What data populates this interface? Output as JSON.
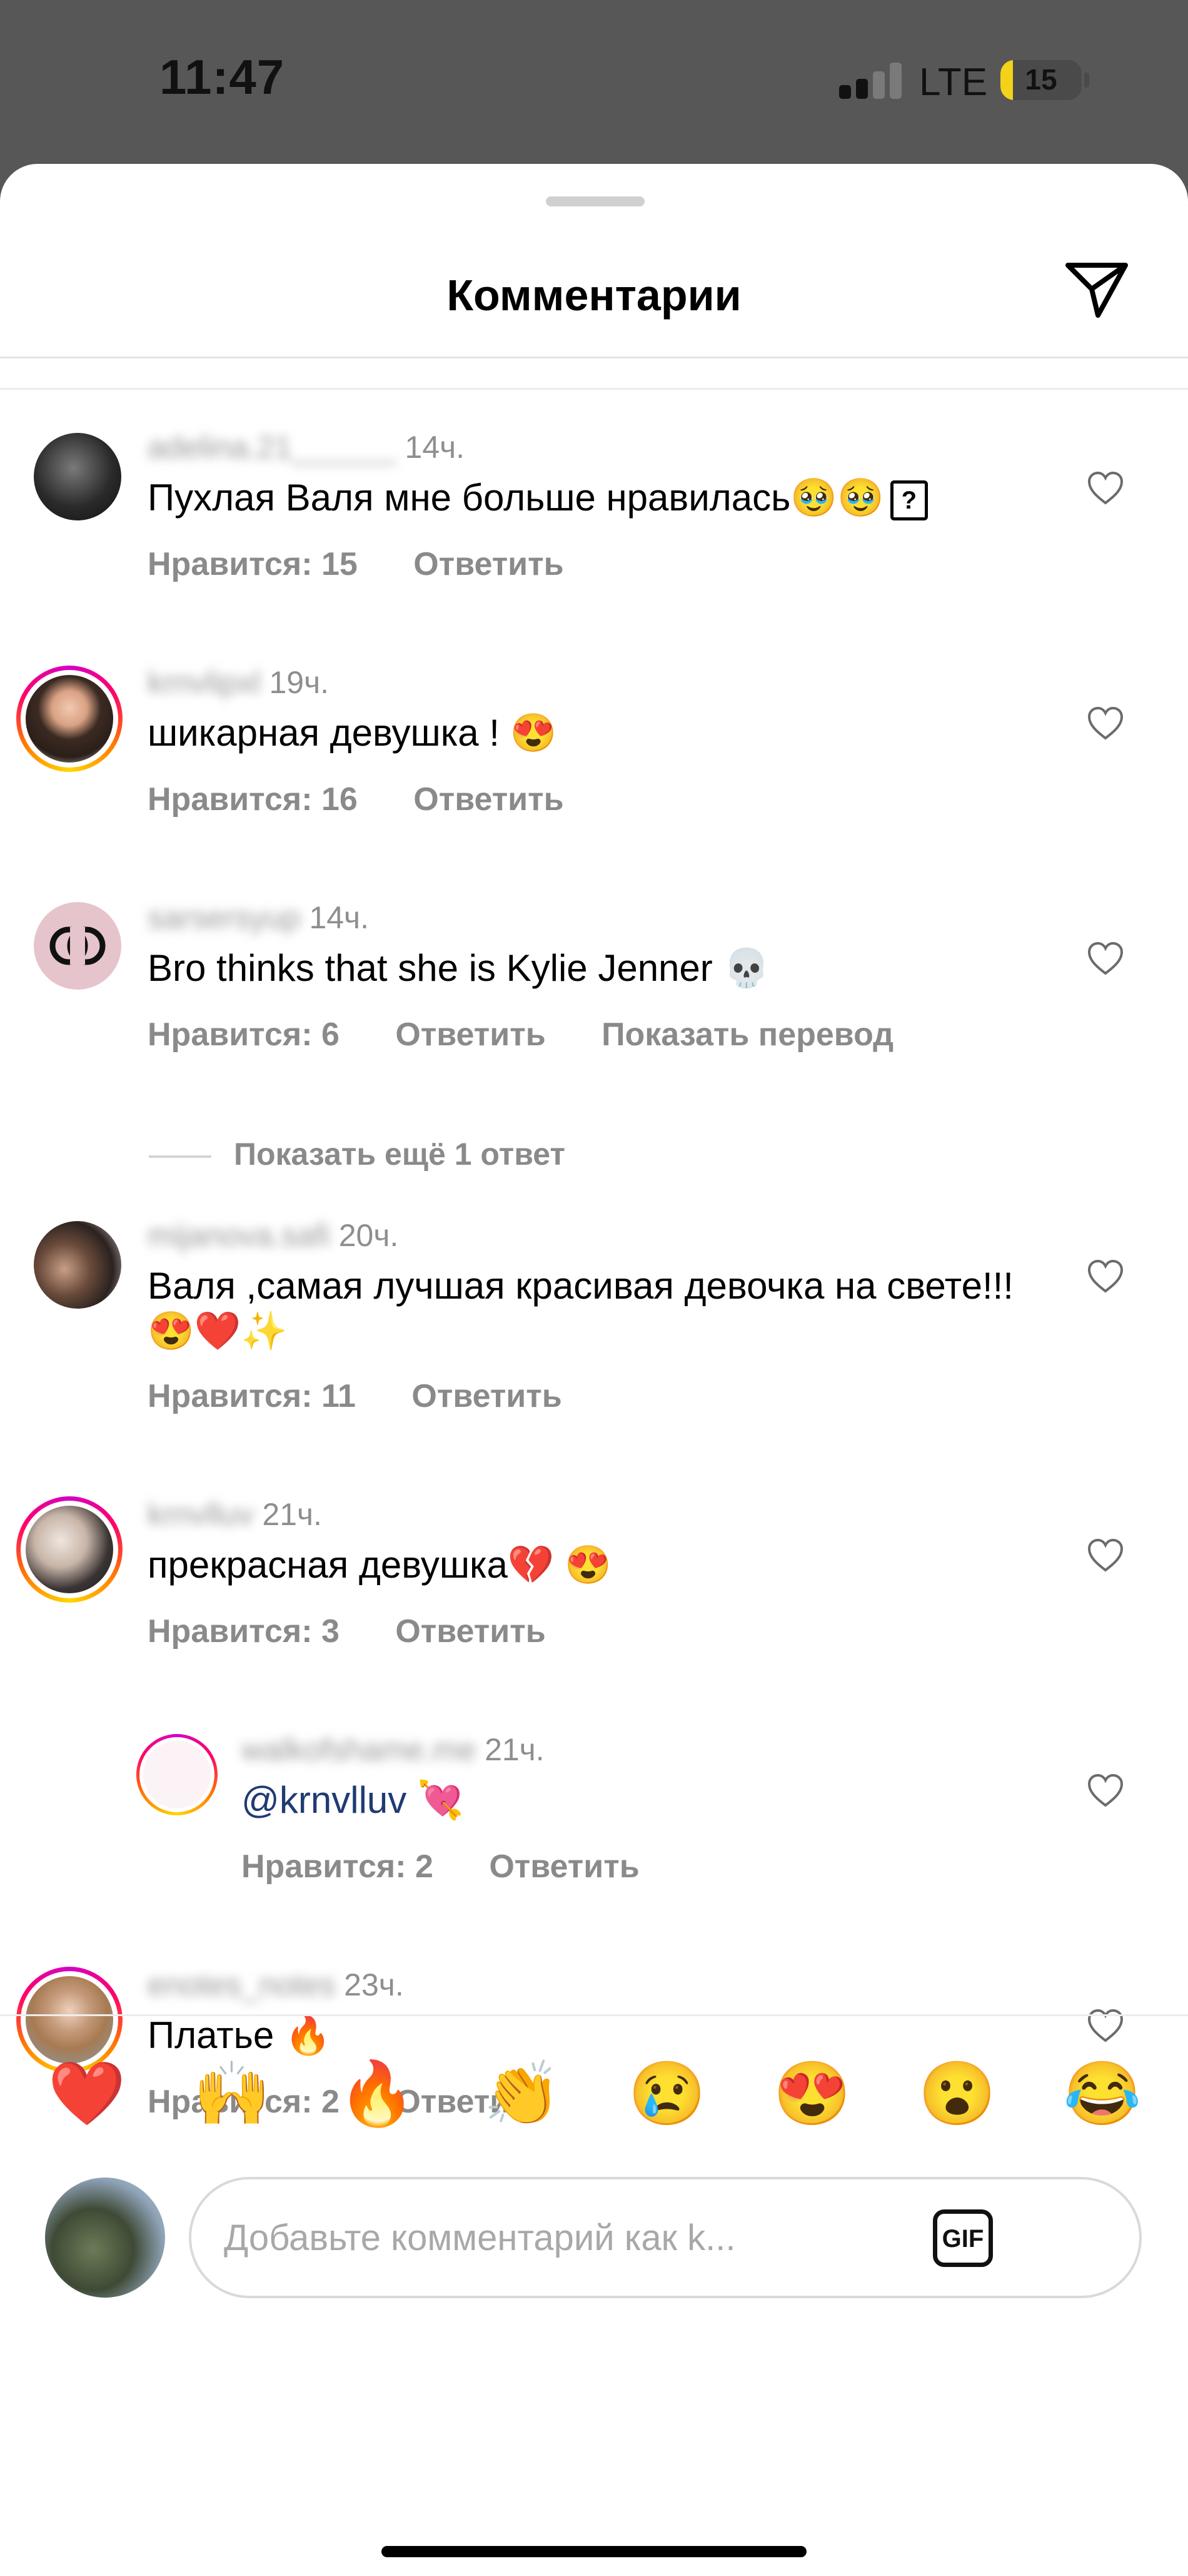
{
  "status": {
    "time": "11:47",
    "network": "LTE",
    "battery": "15",
    "battery_level": 0.15
  },
  "header": {
    "title": "Комментарии",
    "share_icon": "paper-plane-icon"
  },
  "comments": [
    {
      "username": "adelina.21______",
      "time": "14ч.",
      "text": "Пухлая Валя мне больше нравилась🥹🥹",
      "tail": "?",
      "likes": "Нравится: 15",
      "reply": "Ответить"
    },
    {
      "username": "krnvlipxl",
      "time": "19ч.",
      "text": "шикарная девушка ! 😍",
      "likes": "Нравится: 16",
      "reply": "Ответить"
    },
    {
      "username": "sarsersyup",
      "time": "14ч.",
      "text": "Bro thinks that she is Kylie Jenner 💀",
      "likes": "Нравится: 6",
      "reply": "Ответить",
      "translate": "Показать перевод"
    },
    {
      "username": "mijanova.safi",
      "time": "20ч.",
      "text": "Валя ,самая лучшая красивая девочка на свете!!!😍❤️✨",
      "likes": "Нравится: 11",
      "reply": "Ответить"
    },
    {
      "username": "krnvlluv",
      "time": "21ч.",
      "text": "прекрасная девушка💔 😍",
      "likes": "Нравится: 3",
      "reply": "Ответить"
    },
    {
      "username": "walkofshame.me",
      "time": "21ч.",
      "mention": "@krnvlluv",
      "text": " 💘",
      "likes": "Нравится: 2",
      "reply": "Ответить"
    },
    {
      "username": "enotes_notes",
      "time": "23ч.",
      "text": "Платье 🔥",
      "likes": "Нравится: 2",
      "reply": "Ответить"
    }
  ],
  "show_more": "Показать ещё 1 ответ",
  "reactions": [
    "❤️",
    "🙌",
    "🔥",
    "👏",
    "😢",
    "😍",
    "😮",
    "😂"
  ],
  "composer": {
    "placeholder": "Добавьте комментарий как k...",
    "gif": "GIF"
  }
}
